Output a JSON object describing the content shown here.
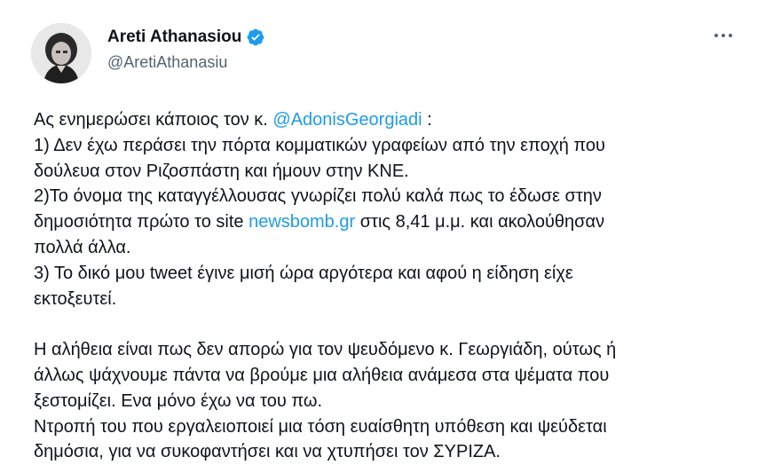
{
  "author": {
    "display_name": "Areti Athanasiou",
    "handle": "@AretiAthanasiu"
  },
  "icons": {
    "verified": "verified-badge-icon",
    "more": "more-options-icon"
  },
  "colors": {
    "link": "#1d9bf0",
    "text": "#0f1419",
    "secondary": "#536471"
  },
  "tweet": {
    "lines": [
      {
        "parts": [
          {
            "text": "Ας ενημερώσει κάποιος τον κ. "
          },
          {
            "text": "@AdonisGeorgiadi",
            "link": true
          },
          {
            "text": " :"
          }
        ]
      },
      {
        "parts": [
          {
            "text": "1) Δεν έχω περάσει την πόρτα κομματικών γραφείων από την εποχή που"
          }
        ]
      },
      {
        "parts": [
          {
            "text": "δούλευα στον Ριζοσπάστη και ήμουν στην ΚΝΕ."
          }
        ]
      },
      {
        "parts": [
          {
            "text": "2)Το όνομα της καταγγέλλουσας γνωρίζει πολύ καλά πως το έδωσε στην"
          }
        ]
      },
      {
        "parts": [
          {
            "text": "δημοσιότητα πρώτο το site "
          },
          {
            "text": "newsbomb.gr",
            "link": true
          },
          {
            "text": " στις 8,41 μ.μ. και ακολούθησαν"
          }
        ]
      },
      {
        "parts": [
          {
            "text": "πολλά άλλα."
          }
        ]
      },
      {
        "parts": [
          {
            "text": "3) Το δικό μου tweet έγινε μισή ώρα αργότερα και αφού η είδηση είχε"
          }
        ]
      },
      {
        "parts": [
          {
            "text": "εκτοξευτεί."
          }
        ]
      },
      {
        "parts": []
      },
      {
        "parts": [
          {
            "text": "Η αλήθεια είναι πως δεν απορώ για τον ψευδόμενο κ. Γεωργιάδη, ούτως ή"
          }
        ]
      },
      {
        "parts": [
          {
            "text": "άλλως ψάχνουμε πάντα να βρούμε μια αλήθεια ανάμεσα στα ψέματα που"
          }
        ]
      },
      {
        "parts": [
          {
            "text": "ξεστομίζει. Ενα μόνο έχω να του πω."
          }
        ]
      },
      {
        "parts": [
          {
            "text": " Ντροπή του που εργαλειοποιεί μια τόση ευαίσθητη υπόθεση και ψεύδεται"
          }
        ]
      },
      {
        "parts": [
          {
            "text": "δημόσια,  για να συκοφαντήσει και να χτυπήσει τον ΣΥΡΙΖΑ."
          }
        ]
      }
    ]
  }
}
